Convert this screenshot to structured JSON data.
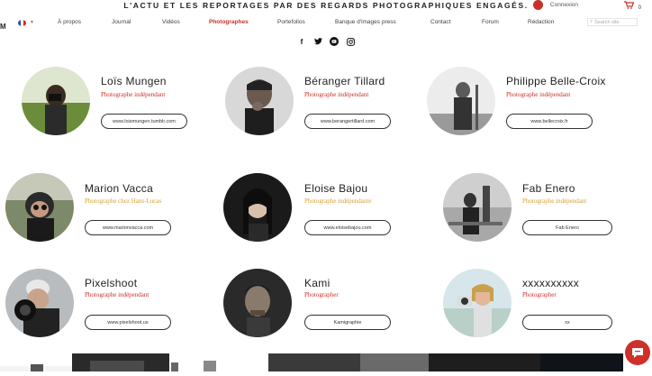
{
  "header": {
    "tagline": "L'ACTU ET LES REPORTAGES PAR DES REGARDS PHOTOGRAPHIQUES ENGAGÉS.",
    "login_label": "Connexion",
    "cart_count": "0",
    "logo": "M"
  },
  "nav": {
    "items": [
      "À propos",
      "Journal",
      "Vidéos",
      "Photographes",
      "Portefolios",
      "Banque d'images press",
      "Contact",
      "Forum",
      "Rédaction"
    ],
    "active": "Photographes",
    "search_placeholder": "Search site"
  },
  "social": [
    "facebook",
    "twitter",
    "youtube",
    "instagram"
  ],
  "photographers": [
    {
      "name": "Loïs Mungen",
      "role": "Photographe indépendant",
      "link": "www.loismungen.tumblr.com",
      "role_color": "#c8302a"
    },
    {
      "name": "Béranger Tillard",
      "role": "Photographe indépendant",
      "link": "www.berangertillard.com",
      "role_color": "#c8302a"
    },
    {
      "name": "Philippe Belle-Croix",
      "role": "Photographe indépendant",
      "link": "www.bellecroix.fr",
      "role_color": "#c8302a"
    },
    {
      "name": "Marion Vacca",
      "role": "Photographe chez Hans-Lucas",
      "link": "www.marionvacca.com",
      "role_color": "#d9a032"
    },
    {
      "name": "Eloise Bajou",
      "role": "Photographe indépendante",
      "link": "www.eloisebajou.com",
      "role_color": "#d9a032"
    },
    {
      "name": "Fab Enero",
      "role": "Photographe indépendant",
      "link": "Fab Enero",
      "role_color": "#d9a032"
    },
    {
      "name": "Pixelshoot",
      "role": "Photographe indépendant",
      "link": "www.pixelshoot.us",
      "role_color": "#c8302a"
    },
    {
      "name": "Kami",
      "role": "Photographer",
      "link": "Kamigraphie",
      "role_color": "#c8302a"
    },
    {
      "name": "xxxxxxxxxx",
      "role": "Photographer",
      "link": "xx",
      "role_color": "#c8302a"
    }
  ],
  "colors": {
    "accent": "#c8302a",
    "gold": "#d9a032"
  }
}
